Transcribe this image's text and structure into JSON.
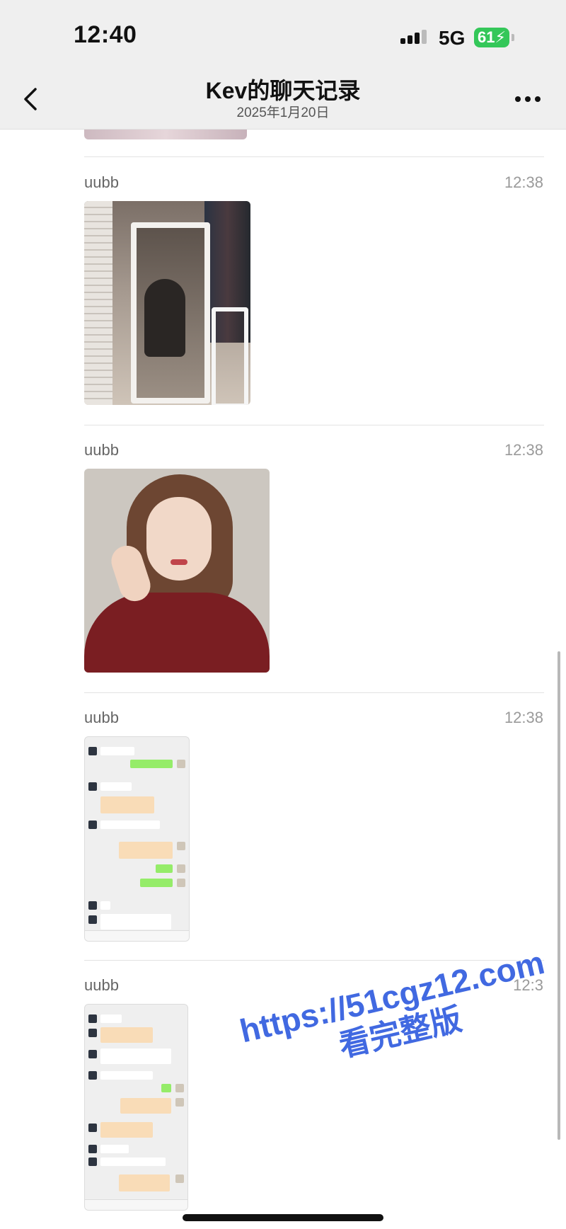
{
  "status_bar": {
    "time": "12:40",
    "network": "5G",
    "battery": "61"
  },
  "nav": {
    "title": "Kev的聊天记录",
    "subtitle": "2025年1月20日",
    "back_icon": "chevron-left-icon",
    "more_icon": "ellipsis-icon"
  },
  "messages": [
    {
      "sender": "uubb",
      "time": "12:38",
      "content": "image"
    },
    {
      "sender": "uubb",
      "time": "12:38",
      "content": "image"
    },
    {
      "sender": "uubb",
      "time": "12:38",
      "content": "chat-screenshot"
    },
    {
      "sender": "uubb",
      "time": "12:3",
      "content": "chat-screenshot"
    }
  ],
  "watermark": {
    "line1": "https://51cgz12.com",
    "line2": "看完整版"
  },
  "colors": {
    "bar_bg": "#efefef",
    "battery": "#34c759",
    "watermark": "#4169e1"
  }
}
